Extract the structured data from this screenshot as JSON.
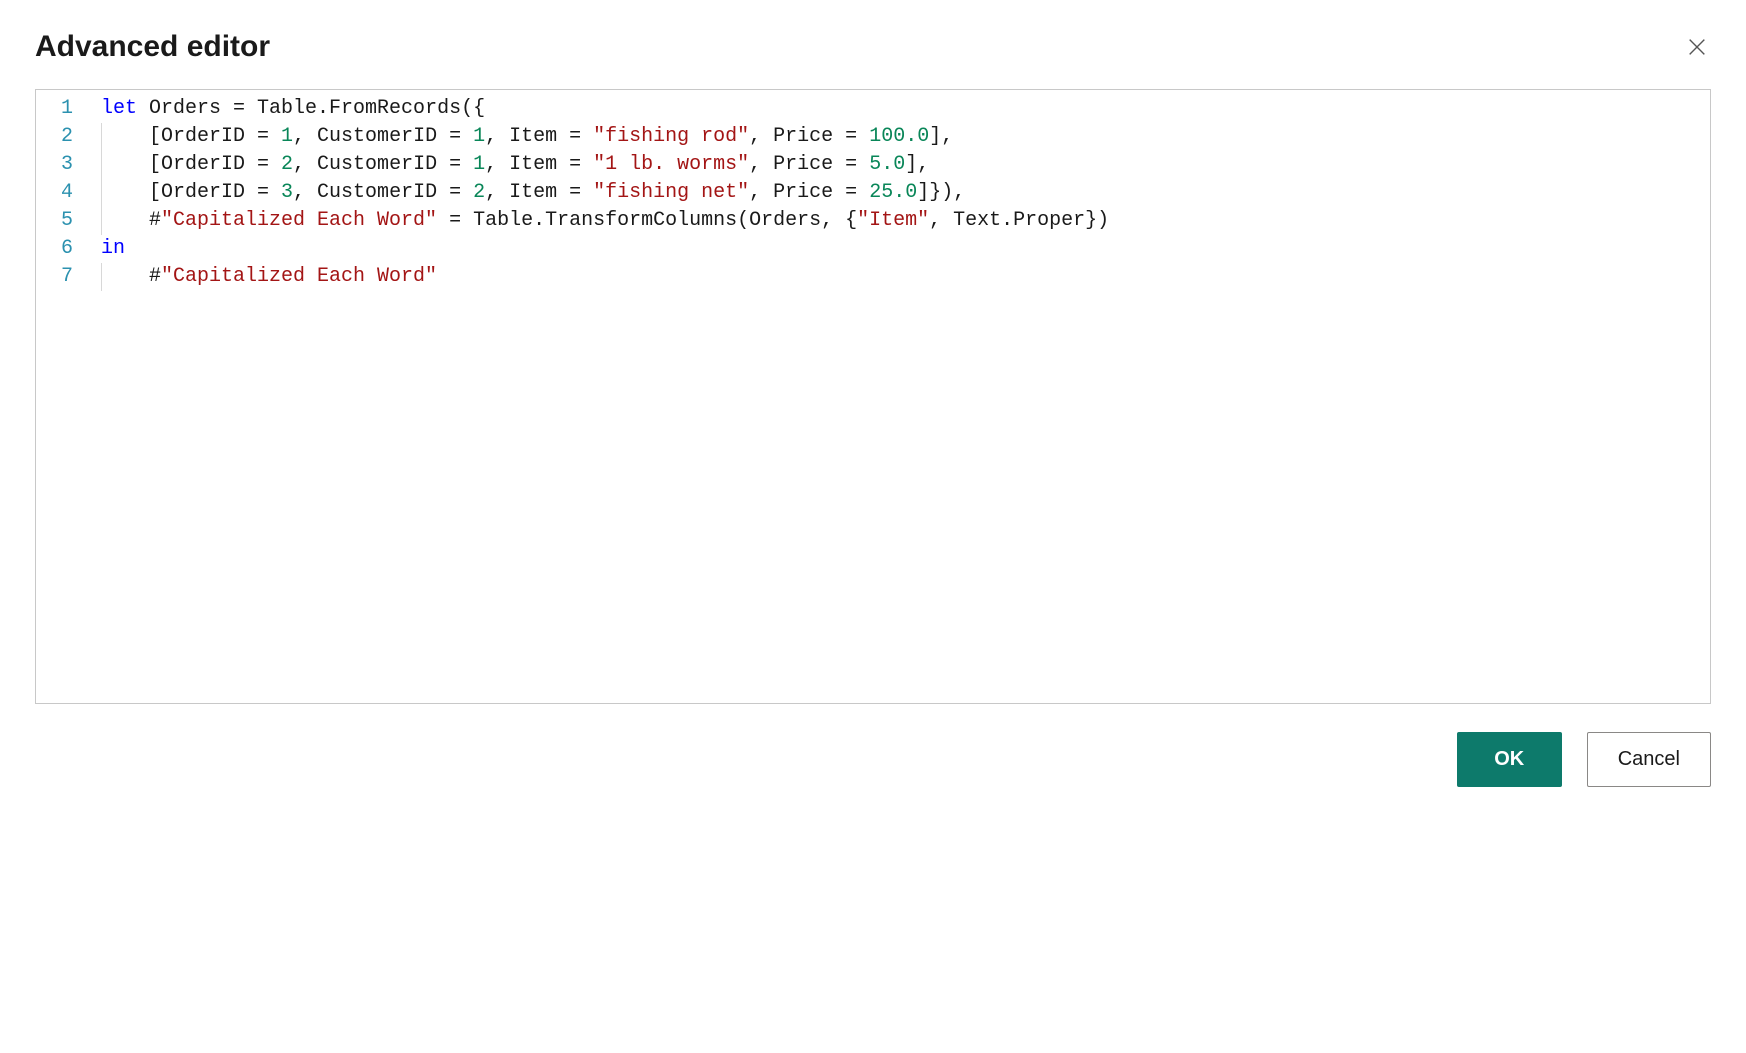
{
  "dialog": {
    "title": "Advanced editor",
    "buttons": {
      "ok": "OK",
      "cancel": "Cancel"
    }
  },
  "editor": {
    "lines": [
      {
        "n": "1",
        "indent": 0,
        "tokens": [
          {
            "t": "kw",
            "v": "let"
          },
          {
            "t": "",
            "v": " Orders = Table.FromRecords({"
          }
        ]
      },
      {
        "n": "2",
        "indent": 1,
        "tokens": [
          {
            "t": "",
            "v": "    [OrderID = "
          },
          {
            "t": "num",
            "v": "1"
          },
          {
            "t": "",
            "v": ", CustomerID = "
          },
          {
            "t": "num",
            "v": "1"
          },
          {
            "t": "",
            "v": ", Item = "
          },
          {
            "t": "str",
            "v": "\"fishing rod\""
          },
          {
            "t": "",
            "v": ", Price = "
          },
          {
            "t": "num",
            "v": "100.0"
          },
          {
            "t": "",
            "v": "],"
          }
        ]
      },
      {
        "n": "3",
        "indent": 1,
        "tokens": [
          {
            "t": "",
            "v": "    [OrderID = "
          },
          {
            "t": "num",
            "v": "2"
          },
          {
            "t": "",
            "v": ", CustomerID = "
          },
          {
            "t": "num",
            "v": "1"
          },
          {
            "t": "",
            "v": ", Item = "
          },
          {
            "t": "str",
            "v": "\"1 lb. worms\""
          },
          {
            "t": "",
            "v": ", Price = "
          },
          {
            "t": "num",
            "v": "5.0"
          },
          {
            "t": "",
            "v": "],"
          }
        ]
      },
      {
        "n": "4",
        "indent": 1,
        "tokens": [
          {
            "t": "",
            "v": "    [OrderID = "
          },
          {
            "t": "num",
            "v": "3"
          },
          {
            "t": "",
            "v": ", CustomerID = "
          },
          {
            "t": "num",
            "v": "2"
          },
          {
            "t": "",
            "v": ", Item = "
          },
          {
            "t": "str",
            "v": "\"fishing net\""
          },
          {
            "t": "",
            "v": ", Price = "
          },
          {
            "t": "num",
            "v": "25.0"
          },
          {
            "t": "",
            "v": "]}),"
          }
        ]
      },
      {
        "n": "5",
        "indent": 1,
        "tokens": [
          {
            "t": "",
            "v": "    #"
          },
          {
            "t": "str",
            "v": "\"Capitalized Each Word\""
          },
          {
            "t": "",
            "v": " = Table.TransformColumns(Orders, {"
          },
          {
            "t": "str",
            "v": "\"Item\""
          },
          {
            "t": "",
            "v": ", Text.Proper})"
          }
        ]
      },
      {
        "n": "6",
        "indent": 0,
        "tokens": [
          {
            "t": "kw",
            "v": "in"
          }
        ]
      },
      {
        "n": "7",
        "indent": 1,
        "tokens": [
          {
            "t": "",
            "v": "    #"
          },
          {
            "t": "str",
            "v": "\"Capitalized Each Word\""
          }
        ]
      }
    ]
  }
}
